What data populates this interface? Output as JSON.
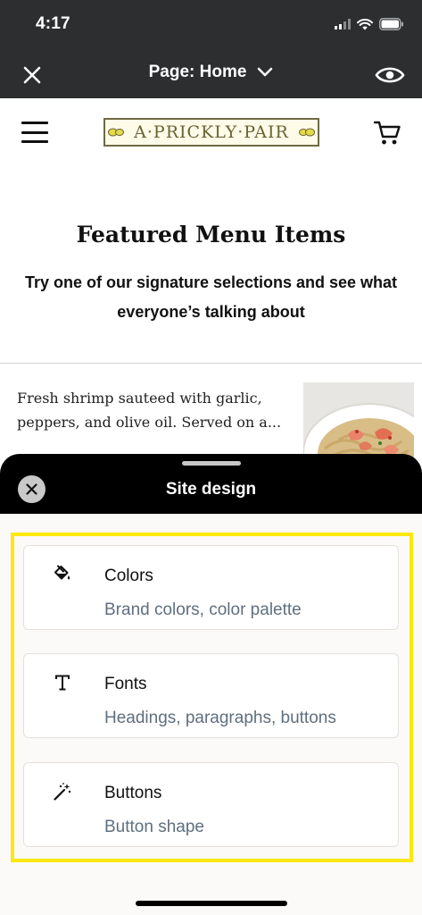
{
  "status_bar": {
    "time": "4:17"
  },
  "editor_bar": {
    "close_icon": "close-icon",
    "page_selector_label": "Page: Home",
    "dropdown_icon": "chevron-down-icon",
    "preview_icon": "eye-icon",
    "background": "#2c2e30"
  },
  "site": {
    "logo_text": "A·Prickly·Pair",
    "menu_icon": "hamburger-menu-icon",
    "cart_icon": "shopping-cart-icon",
    "featured_title": "Featured Menu Items",
    "featured_subtitle": "Try one of our signature selections and see what everyone’s talking about",
    "menu_item": {
      "description": "Fresh shrimp sauteed with garlic, peppers, and olive oil. Served on a..."
    }
  },
  "sheet": {
    "title": "Site design",
    "close_icon": "close-icon",
    "highlight_color": "#fde80f",
    "options": [
      {
        "title": "Colors",
        "description": "Brand colors, color palette",
        "icon": "paint-bucket-icon"
      },
      {
        "title": "Fonts",
        "description": "Headings, paragraphs, buttons",
        "icon": "font-icon"
      },
      {
        "title": "Buttons",
        "description": "Button shape",
        "icon": "magic-wand-icon"
      }
    ]
  }
}
